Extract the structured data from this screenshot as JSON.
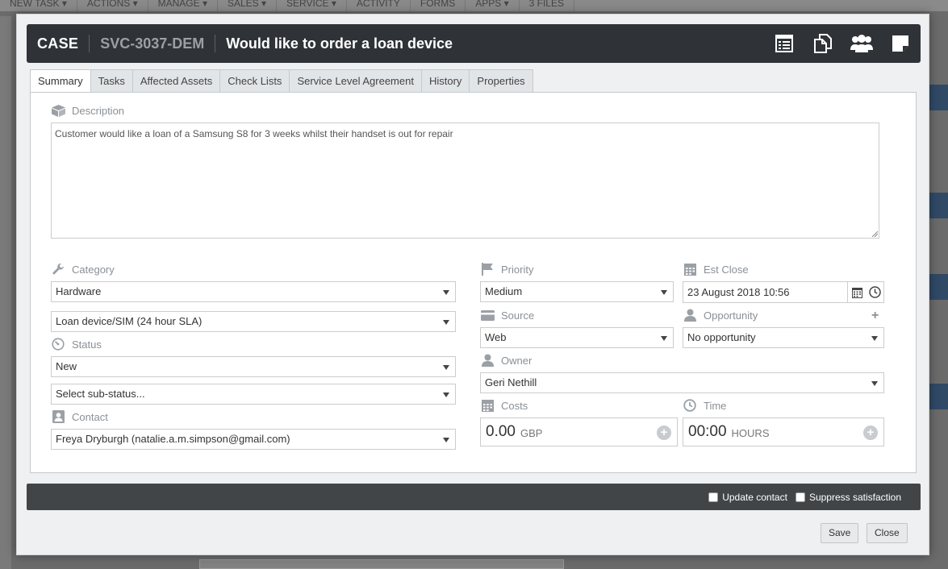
{
  "background": {
    "menu": [
      "NEW TASK ▾",
      "ACTIONS ▾",
      "MANAGE ▾",
      "SALES ▾",
      "SERVICE ▾",
      "ACTIVITY",
      "FORMS",
      "APPS ▾",
      "3 FILES"
    ]
  },
  "header": {
    "type": "CASE",
    "reference": "SVC-3037-DEM",
    "title": "Would like to order a loan device",
    "icons": [
      "form-icon",
      "copy-icon",
      "people-icon",
      "note-icon"
    ]
  },
  "tabs": [
    {
      "label": "Summary",
      "active": true
    },
    {
      "label": "Tasks"
    },
    {
      "label": "Affected Assets"
    },
    {
      "label": "Check Lists"
    },
    {
      "label": "Service Level Agreement"
    },
    {
      "label": "History"
    },
    {
      "label": "Properties"
    }
  ],
  "summary": {
    "description_label": "Description",
    "description": "Customer would like a loan of a Samsung S8 for 3 weeks whilst their handset is out for repair",
    "category_label": "Category",
    "category": "Hardware",
    "subcategory": "Loan device/SIM (24 hour SLA)",
    "status_label": "Status",
    "status": "New",
    "substatus": "Select sub-status...",
    "contact_label": "Contact",
    "contact": "Freya Dryburgh (natalie.a.m.simpson@gmail.com)",
    "priority_label": "Priority",
    "priority": "Medium",
    "est_close_label": "Est Close",
    "est_close": "23 August 2018 10:56",
    "source_label": "Source",
    "source": "Web",
    "opportunity_label": "Opportunity",
    "opportunity": "No opportunity",
    "owner_label": "Owner",
    "owner": "Geri Nethill",
    "costs_label": "Costs",
    "costs_value": "0.00",
    "costs_unit": "GBP",
    "time_label": "Time",
    "time_value": "00:00",
    "time_unit": "HOURS"
  },
  "footer": {
    "update_contact": "Update contact",
    "suppress_satisfaction": "Suppress satisfaction",
    "save": "Save",
    "close": "Close"
  },
  "colors": {
    "header_bg": "#2f3338",
    "footer_bar_bg": "#414548",
    "label_gray": "#8a9096"
  }
}
